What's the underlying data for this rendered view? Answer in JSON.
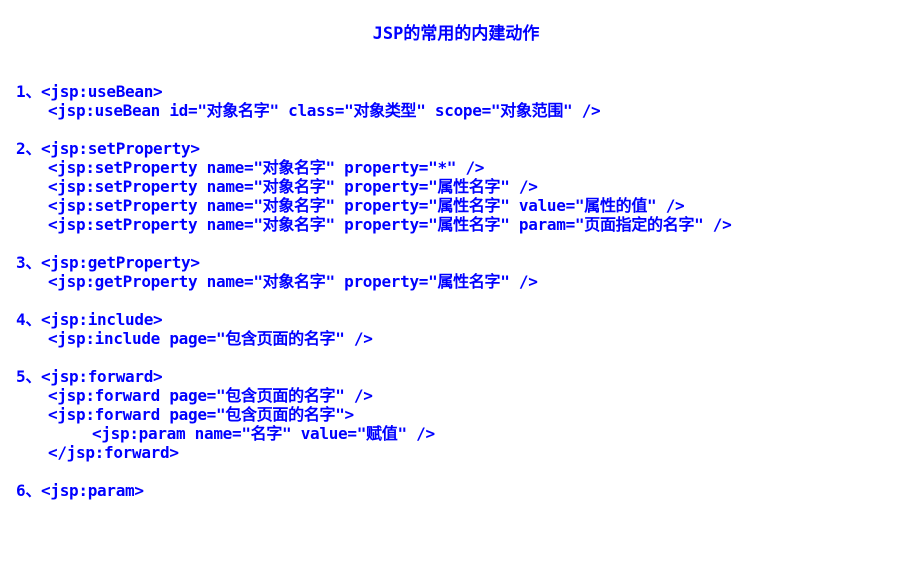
{
  "document": {
    "title": "JSP的常用的内建动作",
    "sections": [
      {
        "heading": "1、<jsp:useBean>",
        "lines": [
          "<jsp:useBean id=\"对象名字\" class=\"对象类型\" scope=\"对象范围\" />"
        ]
      },
      {
        "heading": "2、<jsp:setProperty>",
        "lines": [
          "<jsp:setProperty name=\"对象名字\" property=\"*\" />",
          "<jsp:setProperty name=\"对象名字\" property=\"属性名字\" />",
          "<jsp:setProperty name=\"对象名字\" property=\"属性名字\" value=\"属性的值\" />",
          "<jsp:setProperty name=\"对象名字\" property=\"属性名字\" param=\"页面指定的名字\" />"
        ]
      },
      {
        "heading": "3、<jsp:getProperty>",
        "lines": [
          "<jsp:getProperty name=\"对象名字\" property=\"属性名字\" />"
        ]
      },
      {
        "heading": "4、<jsp:include>",
        "lines": [
          "<jsp:include page=\"包含页面的名字\" />"
        ]
      },
      {
        "heading": "5、<jsp:forward>",
        "lines": [
          "<jsp:forward page=\"包含页面的名字\" />",
          "<jsp:forward page=\"包含页面的名字\">",
          "<jsp:param name=\"名字\" value=\"赋值\" />",
          "</jsp:forward>"
        ]
      },
      {
        "heading": "6、<jsp:param>",
        "lines": []
      }
    ]
  }
}
